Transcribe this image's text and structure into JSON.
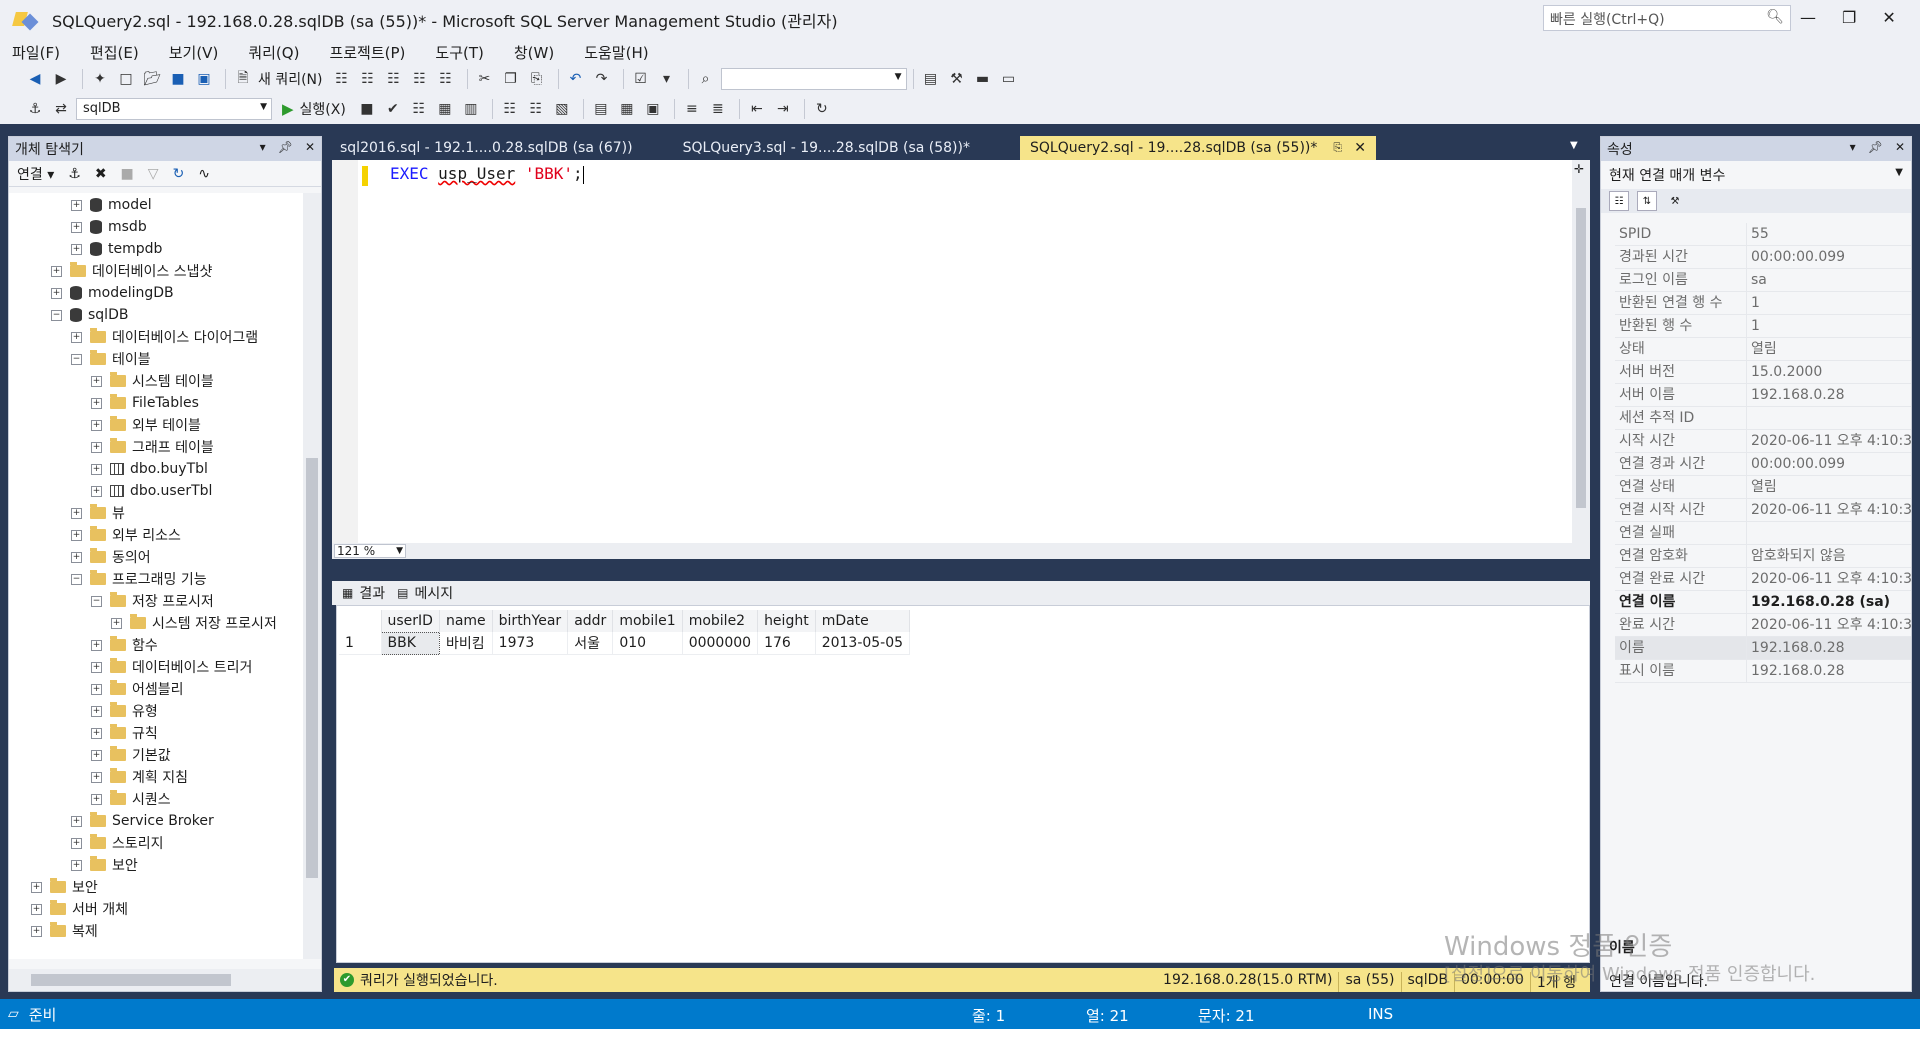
{
  "window": {
    "title": "SQLQuery2.sql - 192.168.0.28.sqlDB (sa (55))* - Microsoft SQL Server Management Studio (관리자)",
    "quick_launch_placeholder": "빠른 실행(Ctrl+Q)"
  },
  "menu": [
    "파일(F)",
    "편집(E)",
    "보기(V)",
    "쿼리(Q)",
    "프로젝트(P)",
    "도구(T)",
    "창(W)",
    "도움말(H)"
  ],
  "toolbar": {
    "new_query": "새 쿼리(N)",
    "database": "sqlDB",
    "execute": "실행(X)"
  },
  "object_explorer": {
    "title": "개체 탐색기",
    "connect": "연결",
    "tree": [
      {
        "label": "보안",
        "indent": 2,
        "icon": "folder",
        "exp": "+"
      },
      {
        "label": "model",
        "indent": 1,
        "icon": "db",
        "exp": "+"
      },
      {
        "label": "msdb",
        "indent": 1,
        "icon": "db",
        "exp": "+"
      },
      {
        "label": "tempdb",
        "indent": 1,
        "icon": "db",
        "exp": "+"
      },
      {
        "label": "데이터베이스 스냅샷",
        "indent": 0,
        "icon": "folder",
        "exp": "+"
      },
      {
        "label": "modelingDB",
        "indent": 0,
        "icon": "db",
        "exp": "+"
      },
      {
        "label": "sqlDB",
        "indent": 0,
        "icon": "db",
        "exp": "-"
      },
      {
        "label": "데이터베이스 다이어그램",
        "indent": 1,
        "icon": "folder",
        "exp": "+"
      },
      {
        "label": "테이블",
        "indent": 1,
        "icon": "folder",
        "exp": "-"
      },
      {
        "label": "시스템 테이블",
        "indent": 2,
        "icon": "folder",
        "exp": "+"
      },
      {
        "label": "FileTables",
        "indent": 2,
        "icon": "folder",
        "exp": "+"
      },
      {
        "label": "외부 테이블",
        "indent": 2,
        "icon": "folder",
        "exp": "+"
      },
      {
        "label": "그래프 테이블",
        "indent": 2,
        "icon": "folder",
        "exp": "+"
      },
      {
        "label": "dbo.buyTbl",
        "indent": 2,
        "icon": "table",
        "exp": "+"
      },
      {
        "label": "dbo.userTbl",
        "indent": 2,
        "icon": "table",
        "exp": "+"
      },
      {
        "label": "뷰",
        "indent": 1,
        "icon": "folder",
        "exp": "+"
      },
      {
        "label": "외부 리소스",
        "indent": 1,
        "icon": "folder",
        "exp": "+"
      },
      {
        "label": "동의어",
        "indent": 1,
        "icon": "folder",
        "exp": "+"
      },
      {
        "label": "프로그래밍 기능",
        "indent": 1,
        "icon": "folder",
        "exp": "-"
      },
      {
        "label": "저장 프로시저",
        "indent": 2,
        "icon": "folder",
        "exp": "-"
      },
      {
        "label": "시스템 저장 프로시저",
        "indent": 3,
        "icon": "folder",
        "exp": "+"
      },
      {
        "label": "함수",
        "indent": 2,
        "icon": "folder",
        "exp": "+"
      },
      {
        "label": "데이터베이스 트리거",
        "indent": 2,
        "icon": "folder",
        "exp": "+"
      },
      {
        "label": "어셈블리",
        "indent": 2,
        "icon": "folder",
        "exp": "+"
      },
      {
        "label": "유형",
        "indent": 2,
        "icon": "folder",
        "exp": "+"
      },
      {
        "label": "규칙",
        "indent": 2,
        "icon": "folder",
        "exp": "+"
      },
      {
        "label": "기본값",
        "indent": 2,
        "icon": "folder",
        "exp": "+"
      },
      {
        "label": "계획 지침",
        "indent": 2,
        "icon": "folder",
        "exp": "+"
      },
      {
        "label": "시퀀스",
        "indent": 2,
        "icon": "folder",
        "exp": "+"
      },
      {
        "label": "Service Broker",
        "indent": 1,
        "icon": "folder",
        "exp": "+"
      },
      {
        "label": "스토리지",
        "indent": 1,
        "icon": "folder",
        "exp": "+"
      },
      {
        "label": "보안",
        "indent": 1,
        "icon": "folder",
        "exp": "+"
      },
      {
        "label": "보안",
        "indent": -1,
        "icon": "folder",
        "exp": "+"
      },
      {
        "label": "서버 개체",
        "indent": -1,
        "icon": "folder",
        "exp": "+"
      },
      {
        "label": "복제",
        "indent": -1,
        "icon": "folder",
        "exp": "+"
      }
    ]
  },
  "tabs": [
    {
      "label": "sql2016.sql - 192.1....0.28.sqlDB (sa (67))",
      "active": false
    },
    {
      "label": "SQLQuery3.sql - 19....28.sqlDB (sa (58))*",
      "active": false
    },
    {
      "label": "SQLQuery2.sql - 19....28.sqlDB (sa (55))*",
      "active": true
    }
  ],
  "editor": {
    "kw": "EXEC",
    "ident": "usp_User",
    "str": "'BBK'",
    "semi": ";",
    "zoom": "121 %"
  },
  "results": {
    "tab_results": "결과",
    "tab_messages": "메시지",
    "columns": [
      "userID",
      "name",
      "birthYear",
      "addr",
      "mobile1",
      "mobile2",
      "height",
      "mDate"
    ],
    "rows": [
      {
        "num": "1",
        "cells": [
          "BBK",
          "바비킴",
          "1973",
          "서울",
          "010",
          "0000000",
          "176",
          "2013-05-05"
        ]
      }
    ]
  },
  "query_status": {
    "message": "쿼리가 실행되었습니다.",
    "server": "192.168.0.28(15.0 RTM)",
    "user": "sa (55)",
    "db": "sqlDB",
    "time": "00:00:00",
    "rows": "1개 행"
  },
  "properties": {
    "title": "속성",
    "selector": "현재 연결 매개 변수",
    "rows": [
      {
        "name": "SPID",
        "value": "55"
      },
      {
        "name": "경과된 시간",
        "value": "00:00:00.099"
      },
      {
        "name": "로그인 이름",
        "value": "sa"
      },
      {
        "name": "반환된 연결 행 수",
        "value": "1"
      },
      {
        "name": "반환된 행 수",
        "value": "1"
      },
      {
        "name": "상태",
        "value": "열림"
      },
      {
        "name": "서버 버전",
        "value": "15.0.2000"
      },
      {
        "name": "서버 이름",
        "value": "192.168.0.28"
      },
      {
        "name": "세션 추적 ID",
        "value": ""
      },
      {
        "name": "시작 시간",
        "value": "2020-06-11 오후 4:10:3"
      },
      {
        "name": "연결 경과 시간",
        "value": "00:00:00.099"
      },
      {
        "name": "연결 상태",
        "value": "열림"
      },
      {
        "name": "연결 시작 시간",
        "value": "2020-06-11 오후 4:10:3"
      },
      {
        "name": "연결 실패",
        "value": ""
      },
      {
        "name": "연결 암호화",
        "value": "암호화되지 않음"
      },
      {
        "name": "연결 완료 시간",
        "value": "2020-06-11 오후 4:10:3"
      },
      {
        "name": "연결 이름",
        "value": "192.168.0.28 (sa)",
        "bold": true
      },
      {
        "name": "완료 시간",
        "value": "2020-06-11 오후 4:10:3"
      },
      {
        "name": "이름",
        "value": "192.168.0.28",
        "sel": true
      },
      {
        "name": "표시 이름",
        "value": "192.168.0.28"
      }
    ],
    "desc_title": "이름",
    "desc_text": "연결 이름입니다."
  },
  "watermark": {
    "line1": "Windows 정품 인증",
    "line2": "[설정]으로 이동하여 Windows 정품 인증합니다."
  },
  "statusbar": {
    "ready": "준비",
    "line": "줄: 1",
    "col": "열: 21",
    "ch": "문자: 21",
    "mode": "INS"
  }
}
